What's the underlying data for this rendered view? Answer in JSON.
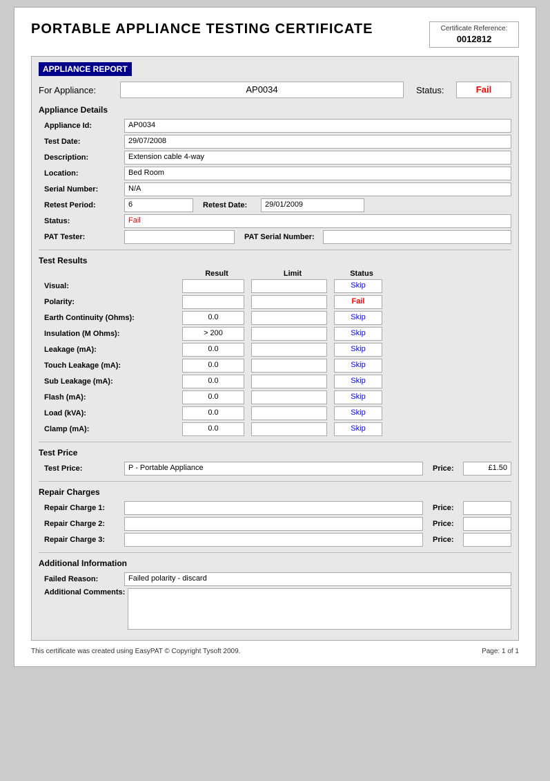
{
  "page": {
    "title": "PORTABLE APPLIANCE TESTING CERTIFICATE",
    "cert_ref_label": "Certificate Reference:",
    "cert_ref_value": "0012812"
  },
  "appliance_report": {
    "section_header": "APPLIANCE REPORT",
    "for_appliance_label": "For Appliance:",
    "for_appliance_value": "AP0034",
    "status_label": "Status:",
    "status_value": "Fail",
    "appliance_details_title": "Appliance Details",
    "appliance_id_label": "Appliance Id:",
    "appliance_id_value": "AP0034",
    "test_date_label": "Test Date:",
    "test_date_value": "29/07/2008",
    "description_label": "Description:",
    "description_value": "Extension cable 4-way",
    "location_label": "Location:",
    "location_value": "Bed Room",
    "serial_number_label": "Serial Number:",
    "serial_number_value": "N/A",
    "retest_period_label": "Retest Period:",
    "retest_period_value": "6",
    "retest_date_label": "Retest Date:",
    "retest_date_value": "29/01/2009",
    "status_field_label": "Status:",
    "status_field_value": "Fail",
    "pat_tester_label": "PAT Tester:",
    "pat_tester_value": "",
    "pat_serial_label": "PAT Serial Number:",
    "pat_serial_value": ""
  },
  "test_results": {
    "title": "Test Results",
    "col_result": "Result",
    "col_limit": "Limit",
    "col_status": "Status",
    "rows": [
      {
        "label": "Visual:",
        "result": "",
        "limit": "",
        "status": "Skip",
        "status_class": "skip"
      },
      {
        "label": "Polarity:",
        "result": "",
        "limit": "",
        "status": "Fail",
        "status_class": "fail"
      },
      {
        "label": "Earth Continuity (Ohms):",
        "result": "0.0",
        "limit": "",
        "status": "Skip",
        "status_class": "skip"
      },
      {
        "label": "Insulation (M Ohms):",
        "result": "> 200",
        "limit": "",
        "status": "Skip",
        "status_class": "skip"
      },
      {
        "label": "Leakage (mA):",
        "result": "0.0",
        "limit": "",
        "status": "Skip",
        "status_class": "skip"
      },
      {
        "label": "Touch Leakage (mA):",
        "result": "0.0",
        "limit": "",
        "status": "Skip",
        "status_class": "skip"
      },
      {
        "label": "Sub Leakage (mA):",
        "result": "0.0",
        "limit": "",
        "status": "Skip",
        "status_class": "skip"
      },
      {
        "label": "Flash (mA):",
        "result": "0.0",
        "limit": "",
        "status": "Skip",
        "status_class": "skip"
      },
      {
        "label": "Load (kVA):",
        "result": "0.0",
        "limit": "",
        "status": "Skip",
        "status_class": "skip"
      },
      {
        "label": "Clamp (mA):",
        "result": "0.0",
        "limit": "",
        "status": "Skip",
        "status_class": "skip"
      }
    ]
  },
  "test_price": {
    "title": "Test Price",
    "label": "Test Price:",
    "value": "P - Portable Appliance",
    "price_label": "Price:",
    "price_value": "£1.50"
  },
  "repair_charges": {
    "title": "Repair Charges",
    "charges": [
      {
        "label": "Repair Charge 1:",
        "value": "",
        "price_label": "Price:",
        "price_value": ""
      },
      {
        "label": "Repair Charge 2:",
        "value": "",
        "price_label": "Price:",
        "price_value": ""
      },
      {
        "label": "Repair Charge 3:",
        "value": "",
        "price_label": "Price:",
        "price_value": ""
      }
    ]
  },
  "additional_info": {
    "title": "Additional Information",
    "failed_reason_label": "Failed Reason:",
    "failed_reason_value": "Failed polarity - discard",
    "additional_comments_label": "Additional Comments:",
    "additional_comments_value": ""
  },
  "footer": {
    "copyright": "This certificate was created using EasyPAT © Copyright Tysoft 2009.",
    "page": "Page: 1 of 1"
  }
}
